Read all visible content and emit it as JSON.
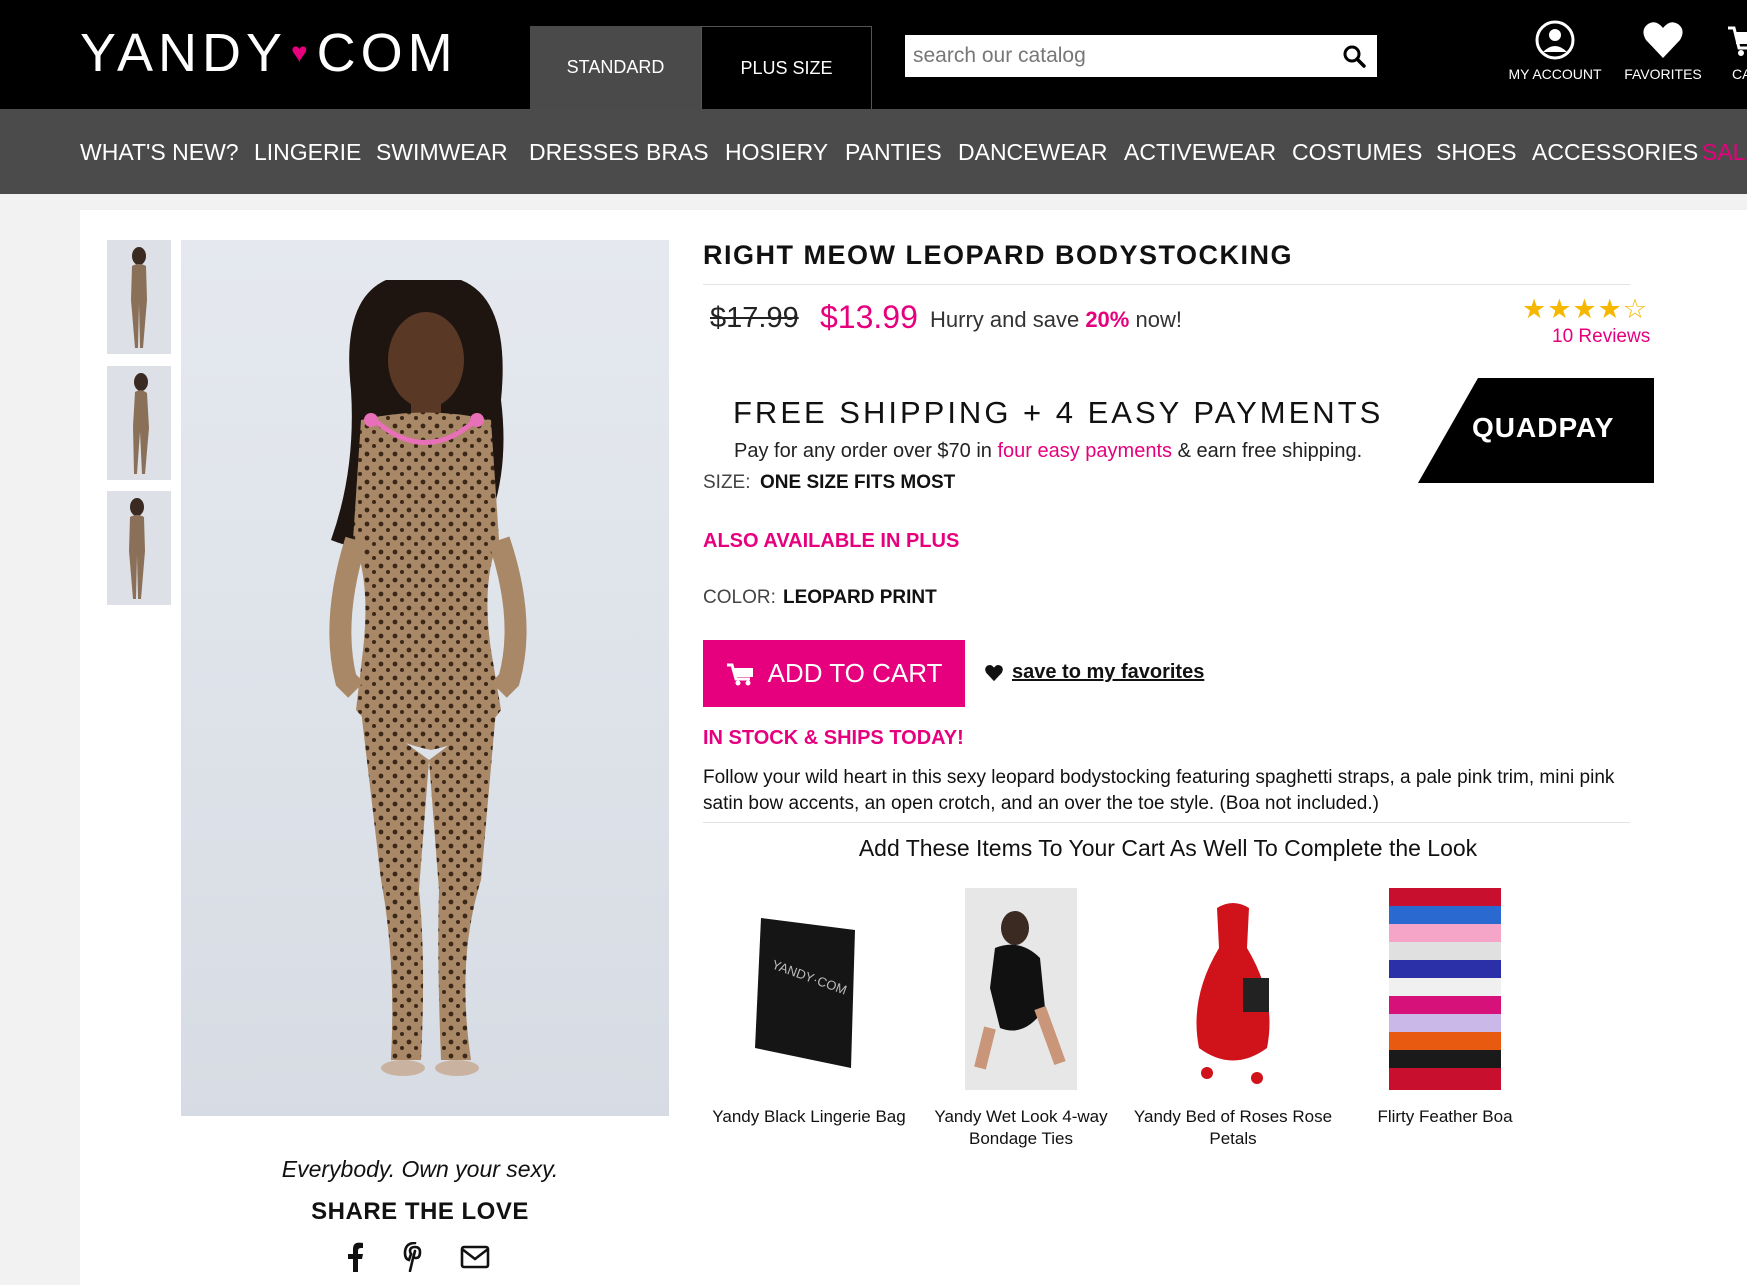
{
  "header": {
    "logo_left": "YANDY",
    "logo_heart": "♥",
    "logo_right": "COM",
    "tabs": [
      "STANDARD",
      "PLUS SIZE"
    ],
    "search_placeholder": "search our catalog",
    "icons": [
      {
        "label": "MY ACCOUNT",
        "icon": "account-icon"
      },
      {
        "label": "FAVORITES",
        "icon": "heart-icon"
      },
      {
        "label": "CA",
        "icon": "cart-icon"
      }
    ]
  },
  "nav": [
    "WHAT'S NEW?",
    "LINGERIE",
    "SWIMWEAR",
    "DRESSES",
    "BRAS",
    "HOSIERY",
    "PANTIES",
    "DANCEWEAR",
    "ACTIVEWEAR",
    "COSTUMES",
    "SHOES",
    "ACCESSORIES",
    "SALE"
  ],
  "product": {
    "title": "RIGHT MEOW LEOPARD BODYSTOCKING",
    "old_price": "$17.99",
    "price": "$13.99",
    "hurry_prefix": "Hurry and save",
    "hurry_pct": "20%",
    "hurry_suffix": "now!",
    "stars": "★★★★☆",
    "rating": 4,
    "reviews": "10 Reviews",
    "size_label": "SIZE:",
    "size_value": "ONE SIZE FITS MOST",
    "plus_link": "ALSO AVAILABLE IN PLUS",
    "color_label": "COLOR:",
    "color_value": "LEOPARD PRINT",
    "add_to_cart": "ADD TO CART",
    "save_favorites": "save to my favorites",
    "stock": "IN STOCK & SHIPS TODAY!",
    "description": "Follow your wild heart in this sexy leopard bodystocking featuring spaghetti straps, a pale pink trim, mini pink satin bow accents, an open crotch, and an over the toe style. (Boa not included.)"
  },
  "shipping": {
    "title": "FREE SHIPPING + 4 EASY PAYMENTS",
    "sub_prefix": "Pay for any order over $70 in",
    "sub_link": "four easy payments",
    "sub_suffix": "& earn free shipping.",
    "badge": "QUADPAY"
  },
  "gallery": {
    "tagline": "Everybody. Own your sexy.",
    "share_title": "SHARE THE LOVE",
    "share_icons": [
      "facebook-icon",
      "pinterest-icon",
      "email-icon"
    ]
  },
  "upsell": {
    "title": "Add These Items To Your Cart As Well To Complete the Look",
    "items": [
      {
        "name": "Yandy Black Lingerie Bag"
      },
      {
        "name": "Yandy Wet Look 4-way Bondage Ties"
      },
      {
        "name": "Yandy Bed of Roses Rose Petals"
      },
      {
        "name": "Flirty Feather Boa"
      }
    ]
  },
  "colors": {
    "brand_pink": "#e6007e",
    "nav_bg": "#4b4b4b",
    "header_bg": "#000000",
    "star": "#f5b700"
  }
}
